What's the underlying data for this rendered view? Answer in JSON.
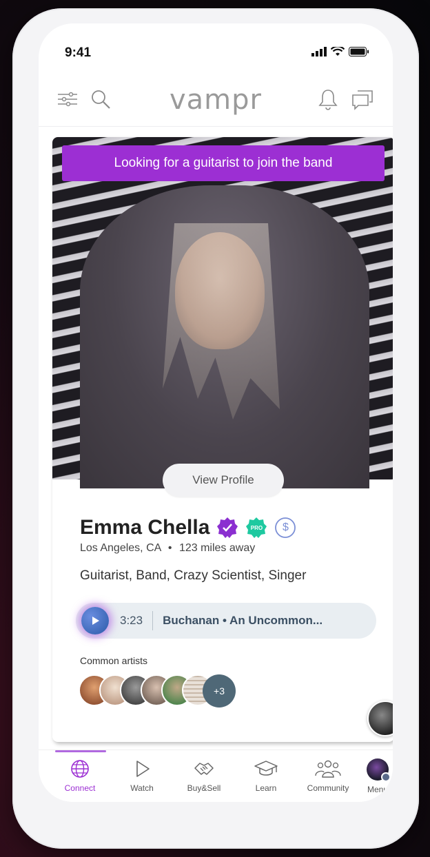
{
  "status_bar": {
    "time": "9:41"
  },
  "header": {
    "logo": "vampr"
  },
  "card": {
    "banner": "Looking for a guitarist to join the band",
    "view_profile": "View Profile",
    "name": "Emma Chella",
    "pro_badge": "PRO",
    "dollar_badge": "$",
    "location": "Los Angeles, CA",
    "separator": "•",
    "distance": "123 miles away",
    "tags": "Guitarist, Band, Crazy Scientist, Singer",
    "player": {
      "time": "3:23",
      "track": "Buchanan • An Uncommon..."
    },
    "common_artists_label": "Common artists",
    "more_artists": "+3"
  },
  "tabs": [
    {
      "label": "Connect",
      "icon": "globe-icon",
      "active": true
    },
    {
      "label": "Watch",
      "icon": "play-icon"
    },
    {
      "label": "Buy&Sell",
      "icon": "handshake-icon"
    },
    {
      "label": "Learn",
      "icon": "graduation-cap-icon"
    },
    {
      "label": "Community",
      "icon": "people-icon"
    },
    {
      "label": "Menu",
      "icon": "avatar-icon"
    }
  ],
  "colors": {
    "accent": "#9c2fd3",
    "pro_badge": "#1ec9a0",
    "dollar_badge": "#7b8fd6",
    "player_bg": "#e9eef2"
  }
}
